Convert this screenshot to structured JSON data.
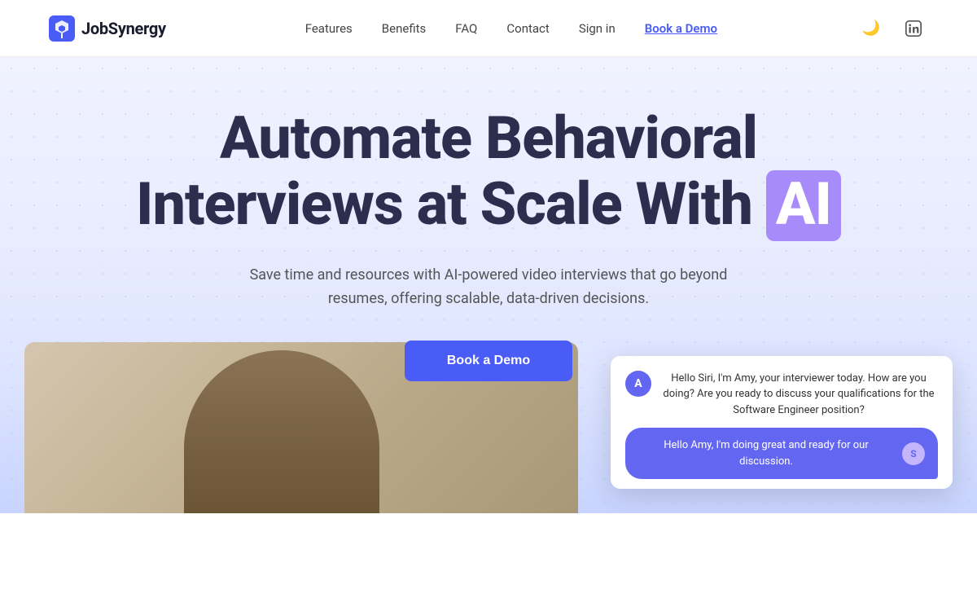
{
  "header": {
    "logo_text": "JobSynergy",
    "nav": {
      "features": "Features",
      "benefits": "Benefits",
      "faq": "FAQ",
      "contact": "Contact",
      "sign_in": "Sign in",
      "book_demo": "Book a Demo"
    }
  },
  "hero": {
    "title_part1": "Automate Behavioral",
    "title_part2": "Interviews at Scale With",
    "title_ai": "AI",
    "subtitle": "Save time and resources with AI-powered video interviews that go beyond resumes, offering scalable, data-driven decisions.",
    "cta_label": "Book a Demo"
  },
  "chat": {
    "amy_message": "Hello Siri, I'm Amy, your interviewer today. How are you doing? Are you ready to discuss your qualifications for the Software Engineer position?",
    "user_message": "Hello Amy, I'm doing great and ready for our discussion.",
    "amy_avatar": "A",
    "user_avatar": "S"
  },
  "icons": {
    "dark_mode": "🌙",
    "linkedin": "in"
  }
}
